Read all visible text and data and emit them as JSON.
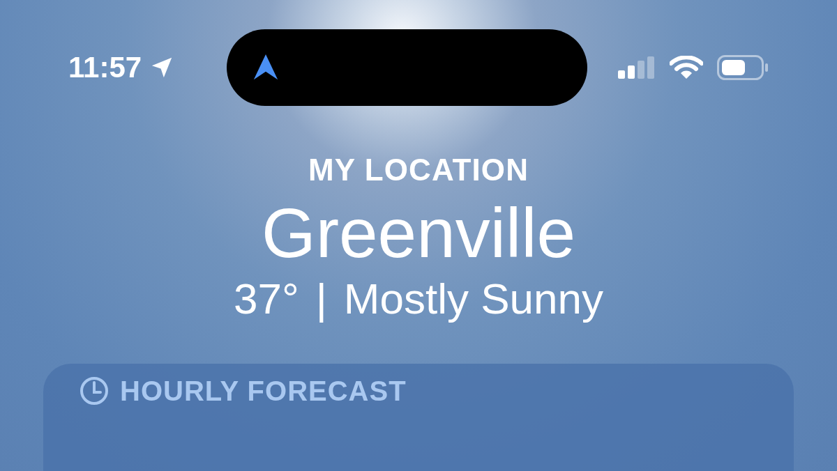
{
  "status_bar": {
    "time": "11:57"
  },
  "header": {
    "label": "MY LOCATION",
    "city": "Greenville",
    "temperature": "37°",
    "separator": "|",
    "condition": "Mostly Sunny"
  },
  "hourly_forecast": {
    "title": "HOURLY FORECAST"
  }
}
